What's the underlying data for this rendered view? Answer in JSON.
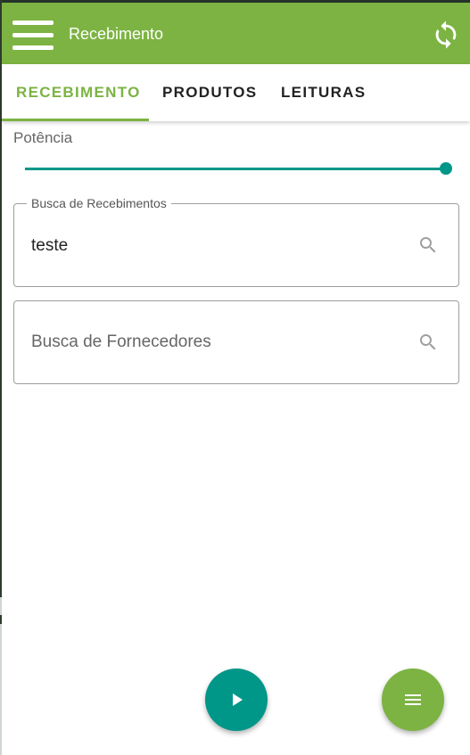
{
  "app_bar": {
    "title": "Recebimento",
    "background_color": "#7cb342",
    "menu_icon": "hamburger-menu-icon",
    "sync_icon": "sync-icon"
  },
  "tabs": [
    {
      "label": "RECEBIMENTO",
      "active": true
    },
    {
      "label": "PRODUTOS",
      "active": false
    },
    {
      "label": "LEITURAS",
      "active": false
    }
  ],
  "power": {
    "label": "Potência",
    "level_fraction": 1.0,
    "accent_color": "#009688"
  },
  "receipt_search": {
    "label": "Busca de Recebimentos",
    "value": "teste",
    "icon": "search-icon"
  },
  "supplier_search": {
    "placeholder": "Busca de Fornecedores",
    "value": "",
    "icon": "search-icon"
  },
  "fabs": {
    "play": {
      "icon": "play-icon",
      "color": "#009688"
    },
    "menu": {
      "icon": "menu-icon",
      "color": "#7cb342"
    }
  }
}
